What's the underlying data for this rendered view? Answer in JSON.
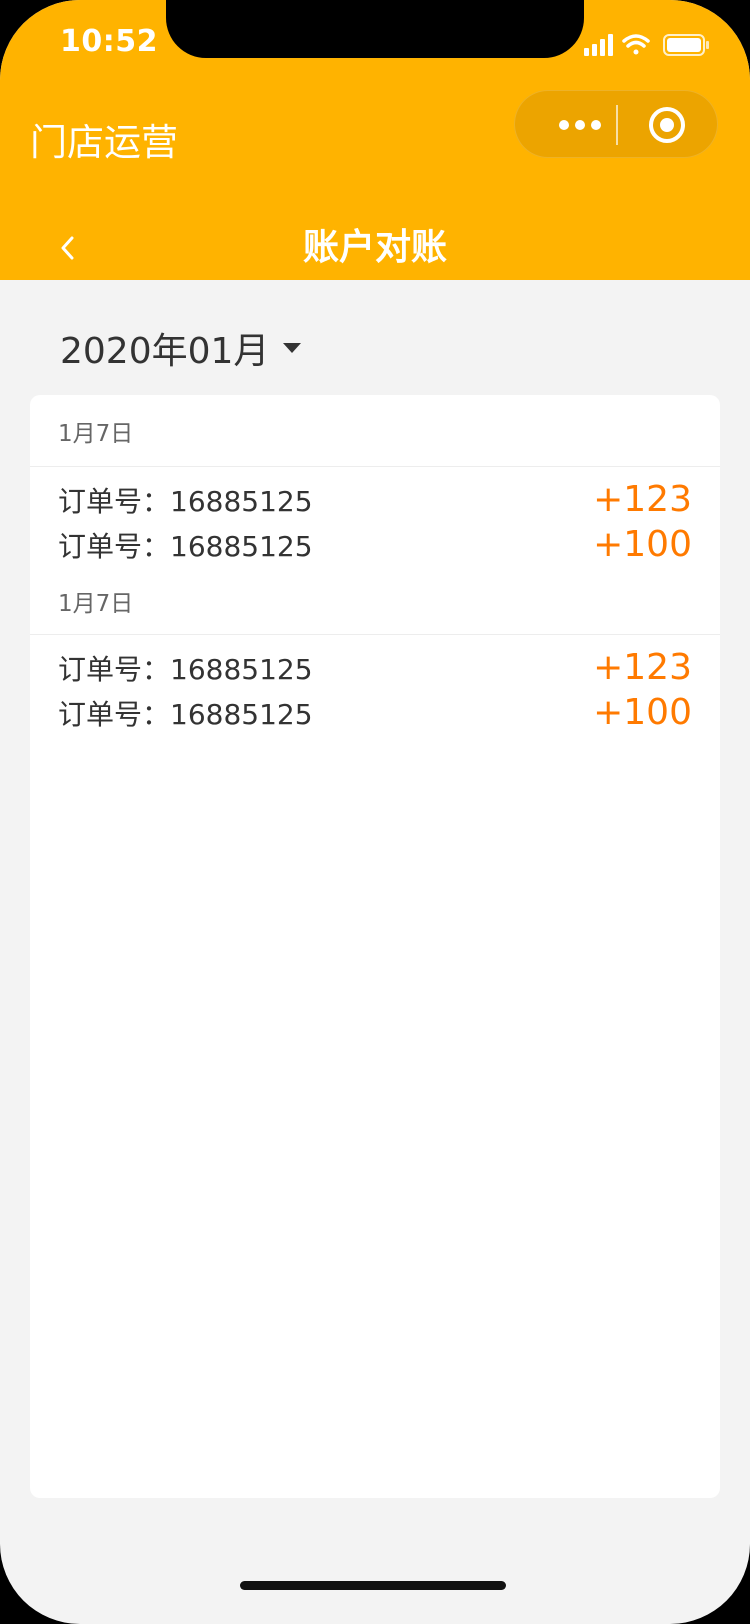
{
  "status_bar": {
    "time": "10:52"
  },
  "app": {
    "title": "门店运营"
  },
  "nav": {
    "title": "账户对账"
  },
  "filter": {
    "month": "2020年01月"
  },
  "groups": [
    {
      "date": "1月7日",
      "items": [
        {
          "order": "订单号：16885125",
          "amount": "+123"
        },
        {
          "order": "订单号：16885125",
          "amount": "+100"
        }
      ]
    },
    {
      "date": "1月7日",
      "items": [
        {
          "order": "订单号：16885125",
          "amount": "+123"
        },
        {
          "order": "订单号：16885125",
          "amount": "+100"
        }
      ]
    }
  ],
  "colors": {
    "header": "#ffb300",
    "amount": "#ff7a00",
    "background": "#f3f3f3"
  },
  "icons": [
    "signal-icon",
    "wifi-icon",
    "battery-icon",
    "more-icon",
    "target-icon",
    "back-chevron-icon",
    "caret-down-icon"
  ]
}
